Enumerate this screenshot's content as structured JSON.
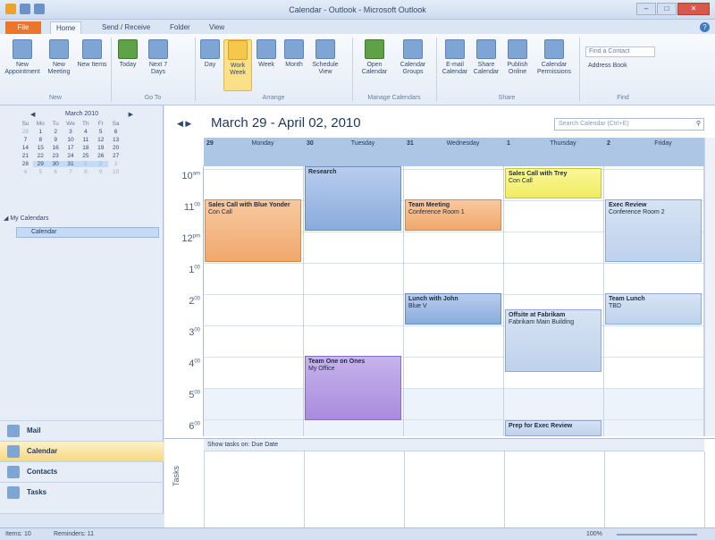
{
  "window": {
    "title": "Calendar - Outlook - Microsoft Outlook"
  },
  "tabs": [
    "File",
    "Home",
    "Send / Receive",
    "Folder",
    "View"
  ],
  "ribbon": {
    "buttons": [
      {
        "label": "New Appointment"
      },
      {
        "label": "New Meeting"
      },
      {
        "label": "New Items"
      },
      {
        "label": "Today"
      },
      {
        "label": "Next 7 Days"
      },
      {
        "label": "Day"
      },
      {
        "label": "Work Week"
      },
      {
        "label": "Week"
      },
      {
        "label": "Month"
      },
      {
        "label": "Schedule View"
      },
      {
        "label": "Open Calendar"
      },
      {
        "label": "Calendar Groups"
      },
      {
        "label": "E-mail Calendar"
      },
      {
        "label": "Share Calendar"
      },
      {
        "label": "Publish Online"
      },
      {
        "label": "Calendar Permissions"
      }
    ],
    "groups": [
      "New",
      "Go To",
      "Arrange",
      "Manage Calendars",
      "Share",
      "Find"
    ],
    "find_contact": "Find a Contact",
    "address_book": "Address Book"
  },
  "mini_calendar": {
    "month": "March 2010",
    "day_headers": [
      "Su",
      "Mo",
      "Tu",
      "We",
      "Th",
      "Fr",
      "Sa"
    ],
    "weeks": [
      [
        "28",
        "1",
        "2",
        "3",
        "4",
        "5",
        "6"
      ],
      [
        "7",
        "8",
        "9",
        "10",
        "11",
        "12",
        "13"
      ],
      [
        "14",
        "15",
        "16",
        "17",
        "18",
        "19",
        "20"
      ],
      [
        "21",
        "22",
        "23",
        "24",
        "25",
        "26",
        "27"
      ],
      [
        "28",
        "29",
        "30",
        "31",
        "1",
        "2",
        "3"
      ],
      [
        "4",
        "5",
        "6",
        "7",
        "8",
        "9",
        "10"
      ]
    ]
  },
  "my_calendars": {
    "heading": "My Calendars",
    "item": "Calendar"
  },
  "nav": [
    "Mail",
    "Calendar",
    "Contacts",
    "Tasks"
  ],
  "calendar": {
    "range": "March 29 - April 02, 2010",
    "search_placeholder": "Search Calendar (Ctrl+E)",
    "days": [
      {
        "num": "29",
        "name": "Monday"
      },
      {
        "num": "30",
        "name": "Tuesday"
      },
      {
        "num": "31",
        "name": "Wednesday"
      },
      {
        "num": "1",
        "name": "Thursday"
      },
      {
        "num": "2",
        "name": "Friday"
      }
    ],
    "times": [
      {
        "h": "10",
        "s": "am"
      },
      {
        "h": "11",
        "s": "00"
      },
      {
        "h": "12",
        "s": "pm"
      },
      {
        "h": "1",
        "s": "00"
      },
      {
        "h": "2",
        "s": "00"
      },
      {
        "h": "3",
        "s": "00"
      },
      {
        "h": "4",
        "s": "00"
      },
      {
        "h": "5",
        "s": "00"
      },
      {
        "h": "6",
        "s": "00"
      }
    ],
    "appointments": [
      {
        "title": "Research",
        "loc": ""
      },
      {
        "title": "Sales Call with Blue Yonder",
        "loc": "Con Call"
      },
      {
        "title": "Team Meeting",
        "loc": "Conference Room 1"
      },
      {
        "title": "Sales Call with Trey",
        "loc": "Con Call"
      },
      {
        "title": "Exec Review",
        "loc": "Conference Room 2"
      },
      {
        "title": "Lunch with John",
        "loc": "Blue V"
      },
      {
        "title": "Team Lunch",
        "loc": "TBD"
      },
      {
        "title": "Offsite at Fabrikam",
        "loc": "Fabrikam Main Building"
      },
      {
        "title": "Team One on Ones",
        "loc": "My Office"
      },
      {
        "title": "Prep for Exec Review",
        "loc": ""
      }
    ],
    "show_tasks": "Show tasks on: Due Date",
    "tasks_label": "Tasks"
  },
  "status": {
    "items": "Items: 10",
    "reminders": "Reminders: 11",
    "zoom": "100%"
  }
}
